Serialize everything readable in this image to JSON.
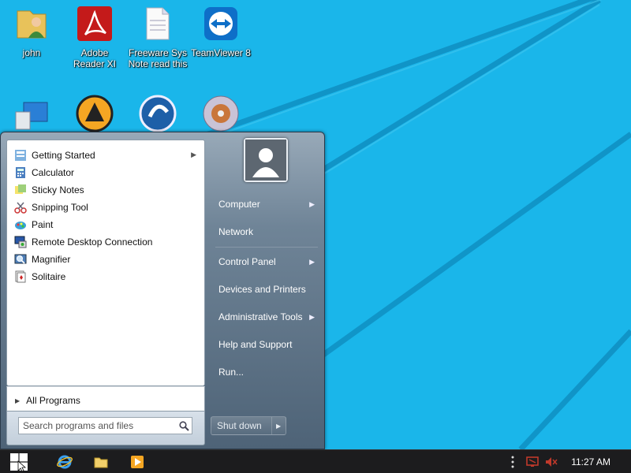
{
  "desktop": {
    "icons": [
      {
        "name": "john",
        "label": "john"
      },
      {
        "name": "adobe-reader",
        "label": "Adobe Reader XI"
      },
      {
        "name": "freeware-note",
        "label": "Freeware Sys Note read this"
      },
      {
        "name": "teamviewer",
        "label": "TeamViewer 8"
      },
      {
        "name": "computer",
        "label": ""
      },
      {
        "name": "aimp",
        "label": ""
      },
      {
        "name": "glary-utilities",
        "label": ""
      },
      {
        "name": "disc-burner",
        "label": ""
      }
    ]
  },
  "start_menu": {
    "programs": [
      {
        "label": "Getting Started",
        "icon": "getting-started-icon",
        "has_submenu": true
      },
      {
        "label": "Calculator",
        "icon": "calculator-icon"
      },
      {
        "label": "Sticky Notes",
        "icon": "sticky-notes-icon"
      },
      {
        "label": "Snipping Tool",
        "icon": "snipping-tool-icon"
      },
      {
        "label": "Paint",
        "icon": "paint-icon"
      },
      {
        "label": "Remote Desktop Connection",
        "icon": "remote-desktop-icon"
      },
      {
        "label": "Magnifier",
        "icon": "magnifier-icon"
      },
      {
        "label": "Solitaire",
        "icon": "solitaire-icon"
      }
    ],
    "all_programs": "All Programs",
    "search": {
      "placeholder": "Search programs and files"
    },
    "right_items": [
      {
        "label": "Computer",
        "has_submenu": true
      },
      {
        "label": "Network",
        "has_submenu": false
      },
      {
        "label": "Control Panel",
        "has_submenu": true
      },
      {
        "label": "Devices and Printers",
        "has_submenu": false
      },
      {
        "label": "Administrative Tools",
        "has_submenu": true
      },
      {
        "label": "Help and Support",
        "has_submenu": false
      },
      {
        "label": "Run...",
        "has_submenu": false
      }
    ],
    "shutdown_label": "Shut down"
  },
  "taskbar": {
    "pinned": [
      "internet-explorer-icon",
      "file-explorer-icon",
      "media-player-icon"
    ],
    "tray": [
      "overflow-dots-icon",
      "network-icon",
      "volume-icon"
    ],
    "clock": "11:27 AM"
  },
  "colors": {
    "desktop": "#1ab6ea",
    "taskbar": "#1c1c1e",
    "start_menu_pane": "#6f8497"
  }
}
